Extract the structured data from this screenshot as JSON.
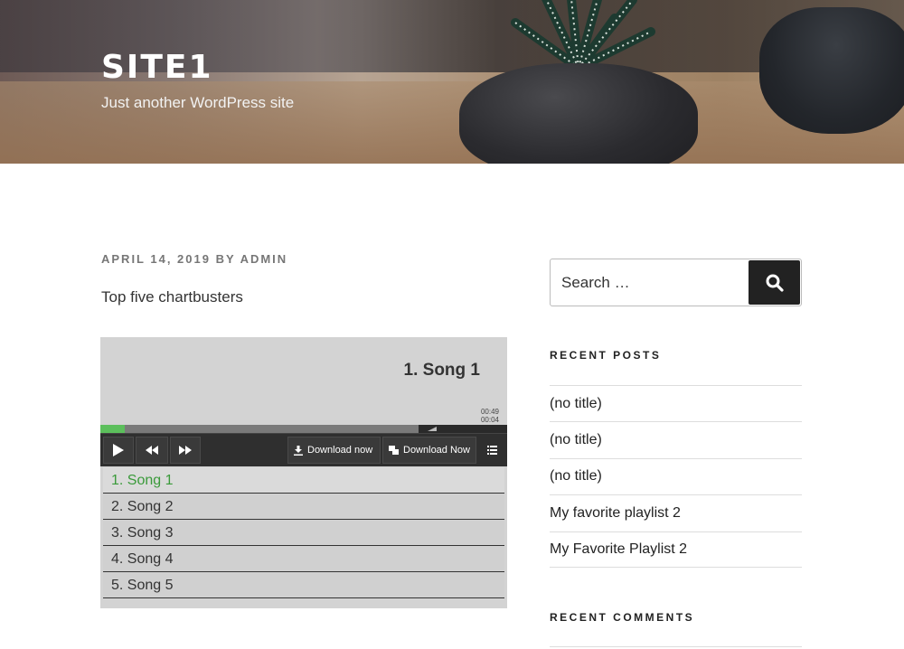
{
  "header": {
    "site_title": "SITE1",
    "site_description": "Just another WordPress site"
  },
  "post": {
    "date": "APRIL 14, 2019",
    "by": "BY",
    "author": "ADMIN",
    "text": "Top five chartbusters"
  },
  "player": {
    "current_title": "1. Song 1",
    "time_total": "00:49",
    "time_elapsed": "00:04",
    "progress_fraction": 0.06,
    "controls": {
      "play": "play-icon",
      "rewind": "rewind-icon",
      "forward": "fast-forward-icon",
      "playlist": "list-icon"
    },
    "download_1": "Download now",
    "download_2": "Download Now",
    "playlist": [
      {
        "label": "1. Song 1",
        "active": true
      },
      {
        "label": "2. Song 2",
        "active": false
      },
      {
        "label": "3. Song 3",
        "active": false
      },
      {
        "label": "4. Song 4",
        "active": false
      },
      {
        "label": "5. Song 5",
        "active": false
      }
    ],
    "accent_color": "#5cbf5c"
  },
  "sidebar": {
    "search_placeholder": "Search …",
    "recent_posts_title": "RECENT POSTS",
    "recent_posts": [
      "(no title)",
      "(no title)",
      "(no title)",
      "My favorite playlist 2",
      "My Favorite Playlist 2"
    ],
    "recent_comments_title": "RECENT COMMENTS"
  }
}
